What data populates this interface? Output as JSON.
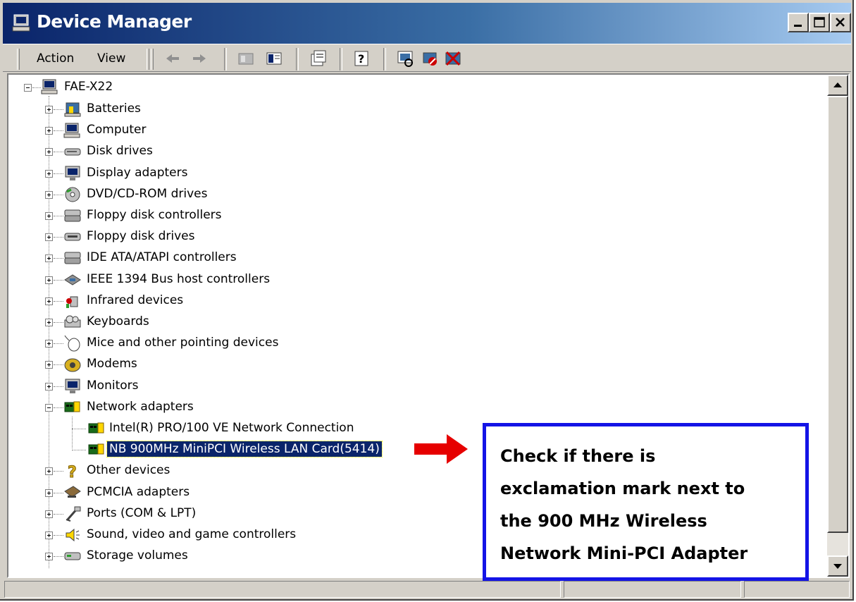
{
  "window": {
    "title": "Device Manager",
    "controls": [
      "minimize",
      "maximize",
      "close"
    ]
  },
  "toolbar": {
    "menus": [
      "Action",
      "View"
    ],
    "icons": [
      "back-icon",
      "forward-icon",
      "computer-icon",
      "show-hide-tree-icon",
      "properties-icon",
      "help-icon",
      "scan-hardware-icon",
      "disable-device-icon",
      "uninstall-device-icon"
    ]
  },
  "tree": {
    "root": "FAE-X22",
    "categories": [
      {
        "label": "Batteries",
        "icon": "battery-icon"
      },
      {
        "label": "Computer",
        "icon": "computer-icon"
      },
      {
        "label": "Disk drives",
        "icon": "disk-drive-icon"
      },
      {
        "label": "Display adapters",
        "icon": "monitor-icon"
      },
      {
        "label": "DVD/CD-ROM drives",
        "icon": "cdrom-icon"
      },
      {
        "label": "Floppy disk controllers",
        "icon": "controller-icon"
      },
      {
        "label": "Floppy disk drives",
        "icon": "floppy-icon"
      },
      {
        "label": "IDE ATA/ATAPI controllers",
        "icon": "controller-icon"
      },
      {
        "label": "IEEE 1394 Bus host controllers",
        "icon": "1394-icon"
      },
      {
        "label": "Infrared devices",
        "icon": "infrared-icon"
      },
      {
        "label": "Keyboards",
        "icon": "keyboard-icon"
      },
      {
        "label": "Mice and other pointing devices",
        "icon": "mouse-icon"
      },
      {
        "label": "Modems",
        "icon": "modem-icon"
      },
      {
        "label": "Monitors",
        "icon": "monitor-icon"
      },
      {
        "label": "Network adapters",
        "icon": "network-card-icon",
        "expanded": true
      }
    ],
    "network_children": [
      {
        "label": "Intel(R) PRO/100 VE Network Connection",
        "selected": false
      },
      {
        "label": "NB 900MHz MiniPCI Wireless LAN Card(5414)",
        "selected": true
      }
    ],
    "categories_after": [
      {
        "label": "Other devices",
        "icon": "unknown-device-icon"
      },
      {
        "label": "PCMCIA adapters",
        "icon": "pcmcia-icon"
      },
      {
        "label": "Ports (COM & LPT)",
        "icon": "port-icon"
      },
      {
        "label": "Sound, video and game controllers",
        "icon": "sound-icon"
      },
      {
        "label": "Storage volumes",
        "icon": "storage-icon"
      }
    ]
  },
  "annotation": {
    "lines": [
      "Check if there is",
      "exclamation mark next to",
      "the 900 MHz Wireless",
      "Network Mini-PCI Adapter"
    ],
    "border_color": "#1414e6",
    "arrow_color": "#e60000"
  },
  "colors": {
    "title_gradient_start": "#0a246a",
    "title_gradient_end": "#a6caf0",
    "chrome": "#d4d0c8",
    "selection": "#0a246a"
  }
}
